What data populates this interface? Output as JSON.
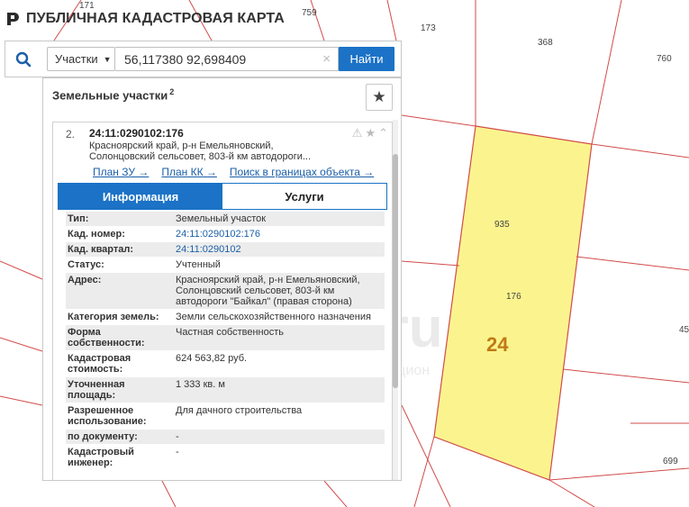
{
  "header": {
    "title": "ПУБЛИЧНАЯ КАДАСТРОВАЯ КАРТА",
    "logo_icon": "pkk-logo-icon"
  },
  "search": {
    "type_label": "Участки",
    "query": "56,117380 92,698409",
    "button_label": "Найти"
  },
  "panel": {
    "title": "Земельные участки",
    "count": "2"
  },
  "card": {
    "index": "2.",
    "cad_number": "24:11:0290102:176",
    "address_line1": "Красноярский край, р-н Емельяновский,",
    "address_line2": "Солонцовский сельсовет, 803-й км автодороги...",
    "links": {
      "plan_zu": "План ЗУ →",
      "plan_kk": "План КК →",
      "search_bounds": "Поиск в границах объекта →"
    },
    "tabs": {
      "info": "Информация",
      "services": "Услуги"
    },
    "rows": [
      {
        "key": "Тип:",
        "value": "Земельный участок"
      },
      {
        "key": "Кад. номер:",
        "value": "24:11:0290102:176"
      },
      {
        "key": "Кад. квартал:",
        "value": "24:11:0290102"
      },
      {
        "key": "Статус:",
        "value": "Учтенный"
      },
      {
        "key": "Адрес:",
        "value": "Красноярский край, р-н Емельяновский, Солонцовский сельсовет, 803-й км автодороги \"Байкал\" (правая сторона)"
      },
      {
        "key": "Категория земель:",
        "value": "Земли сельскохозяйственного назначения"
      },
      {
        "key": "Форма собственности:",
        "value": "Частная собственность"
      },
      {
        "key": "Кадастровая стоимость:",
        "value": "624 563,82 руб."
      },
      {
        "key": "Уточненная площадь:",
        "value": "1 333 кв. м"
      },
      {
        "key": "Разрешенное использование:",
        "value": "Для дачного строительства"
      },
      {
        "key": "по документу:",
        "value": "-"
      },
      {
        "key": "Кадастровый инженер:",
        "value": "-"
      }
    ]
  },
  "map": {
    "labels": [
      "171",
      "759",
      "173",
      "368",
      "760",
      "935",
      "176",
      "45",
      "699"
    ],
    "quarter": "24",
    "highlight_color": "#fbf48e",
    "line_color": "#d24b4b",
    "watermark_main": "au.ru",
    "watermark_sub": "интернет-аукцион"
  }
}
